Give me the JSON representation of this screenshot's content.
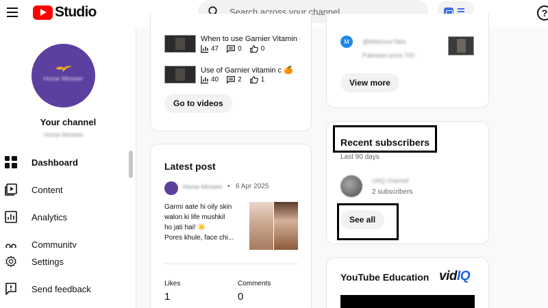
{
  "app": {
    "logo_text": "Studio"
  },
  "search": {
    "placeholder": "Search across your channel"
  },
  "help": {
    "glyph": "?"
  },
  "sidebar": {
    "channel_label": "Your channel",
    "channel_handle_blurred": "Home Minister",
    "avatar_text_blurred": "Home Minister",
    "nav": [
      {
        "label": "Dashboard",
        "icon": "dashboard-icon",
        "active": true
      },
      {
        "label": "Content",
        "icon": "content-icon"
      },
      {
        "label": "Analytics",
        "icon": "analytics-icon"
      },
      {
        "label": "Community",
        "icon": "community-icon"
      },
      {
        "label": "Settings",
        "icon": "gear-icon"
      },
      {
        "label": "Send feedback",
        "icon": "feedback-icon"
      }
    ]
  },
  "top_videos": {
    "items": [
      {
        "title": "When to use Garnier Vitamin C",
        "views": "47",
        "comments": "0",
        "likes": "0"
      },
      {
        "title": "Use of Garnier vitamin c 🍊",
        "views": "40",
        "comments": "2",
        "likes": "1"
      }
    ],
    "button_label": "Go to videos"
  },
  "latest_post": {
    "title": "Latest post",
    "author_blurred": "Home Minister",
    "date": "6 Apr 2025",
    "separator": "•",
    "text_lines": [
      "Garmi aate hi oily skin",
      "walon ki life mushkil",
      "ho jati hai! ☀️",
      "Pores khule, face chi..."
    ],
    "likes_label": "Likes",
    "likes_value": "1",
    "comments_label": "Comments",
    "comments_value": "0"
  },
  "comments_card": {
    "avatar_letter": "M",
    "author_blurred": "@MehnoorTabs",
    "text_blurred": "Pakistani price 700",
    "button_label": "View more"
  },
  "recent_subscribers": {
    "title": "Recent subscribers",
    "subtitle": "Last 90 days",
    "subscriber_name_blurred": "UAQ channel",
    "subscriber_count": "2 subscribers",
    "button_label": "See all"
  },
  "education": {
    "title": "YouTube Education",
    "brand_main": "vid",
    "brand_accent": "IQ"
  },
  "colors": {
    "youtube_red": "#ff0000",
    "avatar_purple": "#5c3f9e",
    "comment_avatar_blue": "#1e88e5",
    "vidiq_blue": "#1c62e0"
  }
}
